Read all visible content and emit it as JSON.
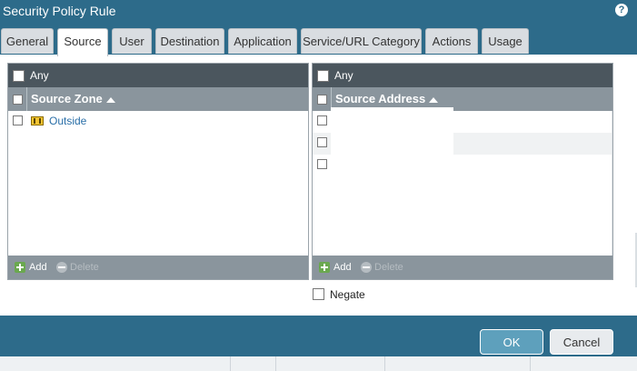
{
  "dialog": {
    "title": "Security Policy Rule",
    "help_icon": "help-icon"
  },
  "tabs": [
    {
      "label": "General"
    },
    {
      "label": "Source"
    },
    {
      "label": "User"
    },
    {
      "label": "Destination"
    },
    {
      "label": "Application"
    },
    {
      "label": "Service/URL Category"
    },
    {
      "label": "Actions"
    },
    {
      "label": "Usage"
    }
  ],
  "active_tab": "Source",
  "source_zone": {
    "any_label": "Any",
    "header": "Source Zone",
    "rows": [
      {
        "label": "Outside",
        "icon": "zone-icon"
      }
    ],
    "add_label": "Add",
    "delete_label": "Delete"
  },
  "source_address": {
    "any_label": "Any",
    "header": "Source Address",
    "add_label": "Add",
    "delete_label": "Delete",
    "negate_label": "Negate"
  },
  "buttons": {
    "ok": "OK",
    "cancel": "Cancel"
  },
  "colors": {
    "titlebar": "#2d6b8a",
    "grid_header_dark": "#4b565e",
    "grid_header": "#8a959d",
    "link": "#2a6fa8",
    "ok_button": "#5ea0bc"
  }
}
